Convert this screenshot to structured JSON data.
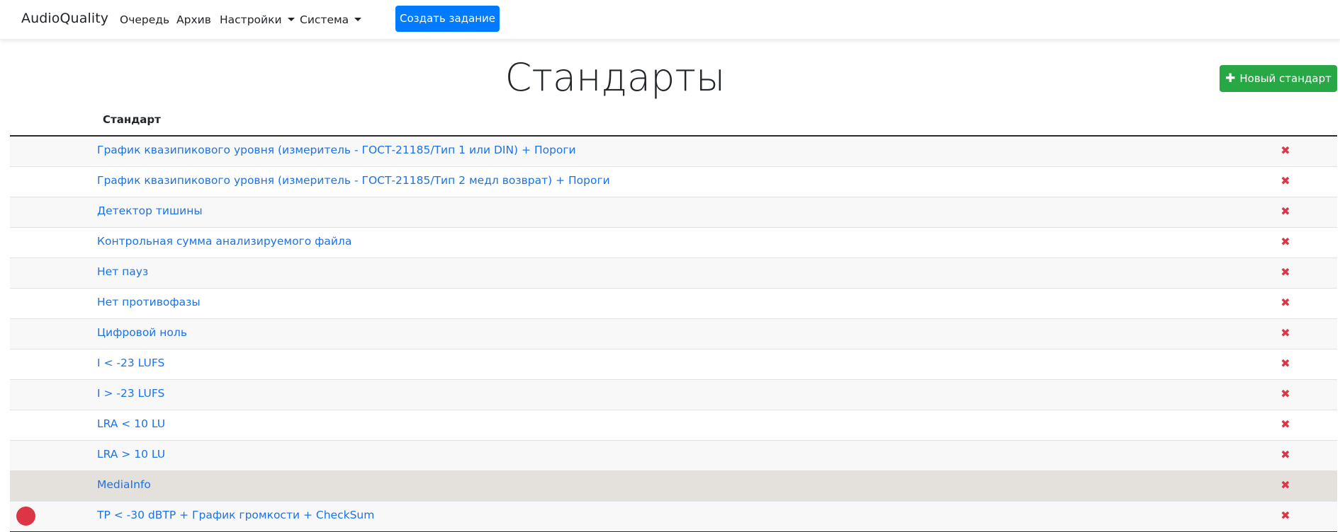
{
  "navbar": {
    "brand": "AudioQuality",
    "items": [
      {
        "label": "Очередь"
      },
      {
        "label": "Архив"
      },
      {
        "label": "Настройки"
      },
      {
        "label": "Система"
      }
    ],
    "create_button": "Создать задание"
  },
  "page": {
    "title": "Стандарты",
    "new_button": "Новый стандарт",
    "column_header": "Стандарт"
  },
  "rows": [
    {
      "name": "График квазипикового уровня (измеритель - ГОСТ-21185/Тип 1 или DIN) + Пороги",
      "delete": "✖"
    },
    {
      "name": "График квазипикового уровня (измеритель - ГОСТ-21185/Тип 2 медл возврат) + Пороги",
      "delete": "✖"
    },
    {
      "name": "Детектор тишины",
      "delete": "✖"
    },
    {
      "name": "Контрольная сумма анализируемого файла",
      "delete": "✖"
    },
    {
      "name": "Нет пауз",
      "delete": "✖"
    },
    {
      "name": "Нет противофазы",
      "delete": "✖"
    },
    {
      "name": "Цифровой ноль",
      "delete": "✖"
    },
    {
      "name": "I < -23 LUFS",
      "delete": "✖"
    },
    {
      "name": "I > -23 LUFS",
      "delete": "✖"
    },
    {
      "name": "LRA < 10 LU",
      "delete": "✖"
    },
    {
      "name": "LRA > 10 LU",
      "delete": "✖"
    },
    {
      "name": "MediaInfo",
      "delete": "✖"
    },
    {
      "name": "TP < -30 dBTP + График громкости + CheckSum",
      "delete": "✖"
    }
  ],
  "colors": {
    "primary": "#007bff",
    "success": "#28a745",
    "danger": "#dc3545",
    "link": "#1a73e8"
  }
}
